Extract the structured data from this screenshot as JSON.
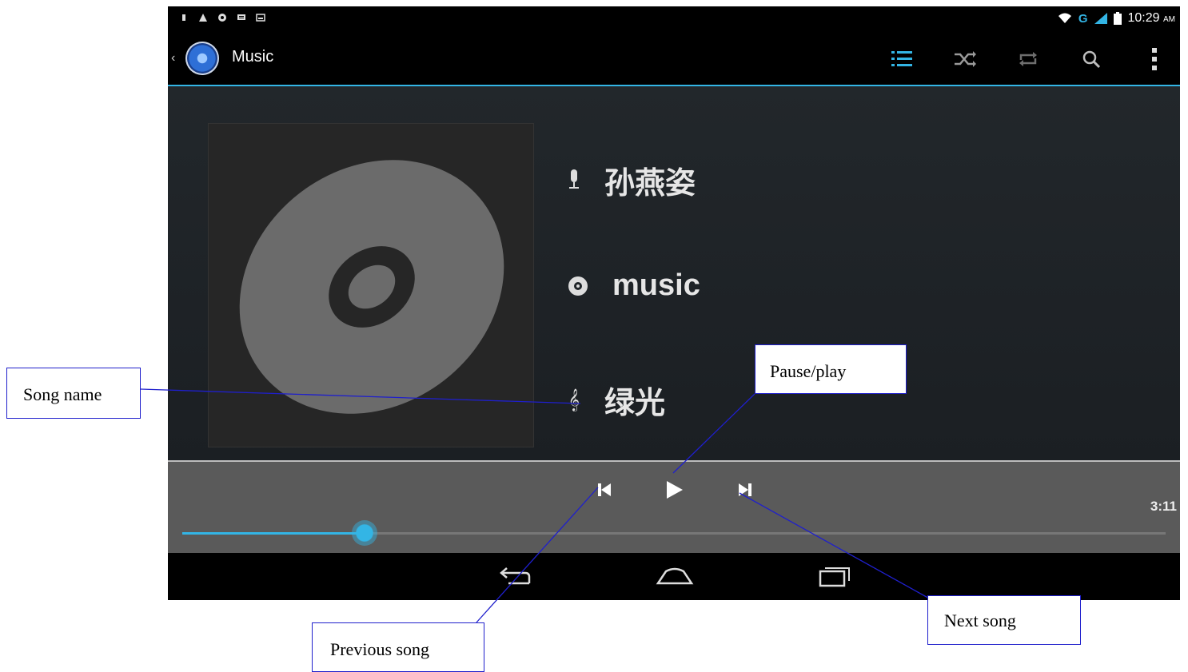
{
  "status_bar": {
    "time": "10:29",
    "ampm": "AM",
    "network": "G"
  },
  "action_bar": {
    "title": "Music",
    "icons": [
      "now-playing-list-icon",
      "shuffle-icon",
      "repeat-icon",
      "search-icon",
      "overflow-menu-icon"
    ]
  },
  "now_playing": {
    "artist": "孙燕姿",
    "album": "music",
    "song": "绿光",
    "duration": "3:11",
    "progress_fraction": 0.185
  },
  "controls": {
    "icons": [
      "previous-icon",
      "play-icon",
      "next-icon"
    ]
  },
  "nav_bar": {
    "icons": [
      "back-icon",
      "home-icon",
      "recent-apps-icon"
    ]
  },
  "callouts": {
    "song_name": "Song name",
    "pause_play": "Pause/play",
    "previous_song": "Previous song",
    "next_song": "Next song"
  },
  "colors": {
    "accent": "#33b5e5",
    "background": "#1d2125",
    "control_bar": "#5a5a5a",
    "callout_border": "#1f1fcc"
  }
}
